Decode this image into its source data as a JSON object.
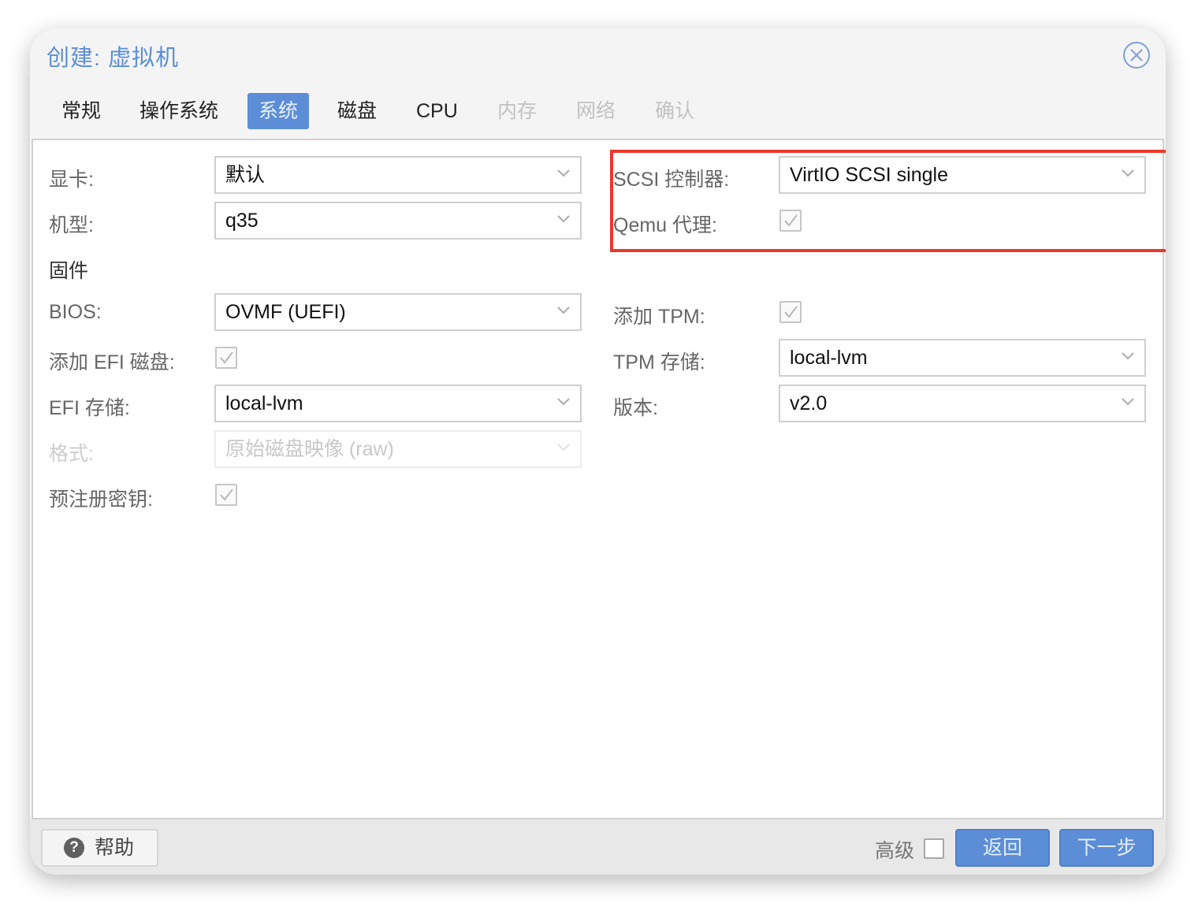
{
  "dialog": {
    "title": "创建: 虚拟机",
    "close_icon": "close-circle-icon"
  },
  "tabs": [
    {
      "label": "常规",
      "state": "normal"
    },
    {
      "label": "操作系统",
      "state": "normal"
    },
    {
      "label": "系统",
      "state": "active"
    },
    {
      "label": "磁盘",
      "state": "normal"
    },
    {
      "label": "CPU",
      "state": "normal"
    },
    {
      "label": "内存",
      "state": "disabled"
    },
    {
      "label": "网络",
      "state": "disabled"
    },
    {
      "label": "确认",
      "state": "disabled"
    }
  ],
  "form": {
    "graphics": {
      "label": "显卡:",
      "value": "默认"
    },
    "machine": {
      "label": "机型:",
      "value": "q35"
    },
    "firmware_heading": "固件",
    "bios": {
      "label": "BIOS:",
      "value": "OVMF (UEFI)"
    },
    "add_efi_disk": {
      "label": "添加 EFI 磁盘:",
      "checked": true
    },
    "efi_storage": {
      "label": "EFI 存储:",
      "value": "local-lvm"
    },
    "format": {
      "label": "格式:",
      "value": "原始磁盘映像 (raw)",
      "disabled": true
    },
    "pre_enroll_keys": {
      "label": "预注册密钥:",
      "checked": true
    },
    "scsi_controller": {
      "label": "SCSI 控制器:",
      "value": "VirtIO SCSI single"
    },
    "qemu_agent": {
      "label": "Qemu 代理:",
      "checked": true
    },
    "add_tpm": {
      "label": "添加 TPM:",
      "checked": true
    },
    "tpm_storage": {
      "label": "TPM 存储:",
      "value": "local-lvm"
    },
    "version": {
      "label": "版本:",
      "value": "v2.0"
    }
  },
  "annotation": {
    "color": "#e8392a"
  },
  "footer": {
    "help_label": "帮助",
    "advanced_label": "高级",
    "advanced_checked": false,
    "back_label": "返回",
    "next_label": "下一步"
  },
  "colors": {
    "accent": "#5b8ed6",
    "highlight": "#e8392a"
  }
}
